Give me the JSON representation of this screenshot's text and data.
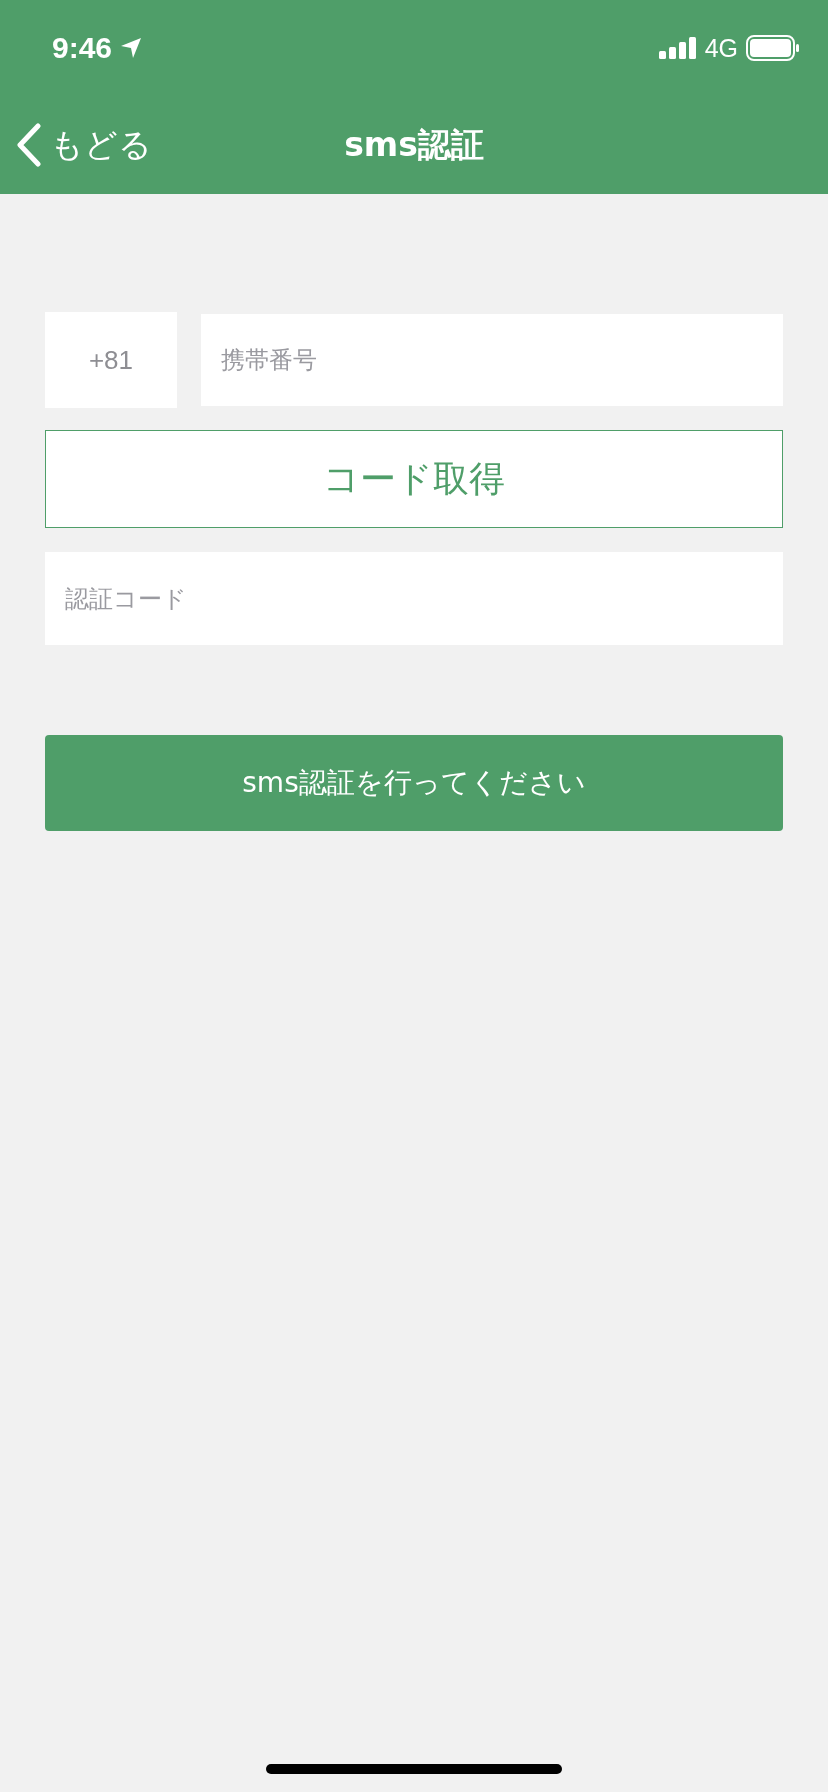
{
  "status_bar": {
    "time": "9:46",
    "network": "4G"
  },
  "nav_bar": {
    "back_label": "もどる",
    "title": "sms認証"
  },
  "phone": {
    "country_code": "+81",
    "placeholder": "携帯番号"
  },
  "get_code_button": "コード取得",
  "code_field": {
    "placeholder": "認証コード"
  },
  "submit_button": "sms認証を行ってください"
}
